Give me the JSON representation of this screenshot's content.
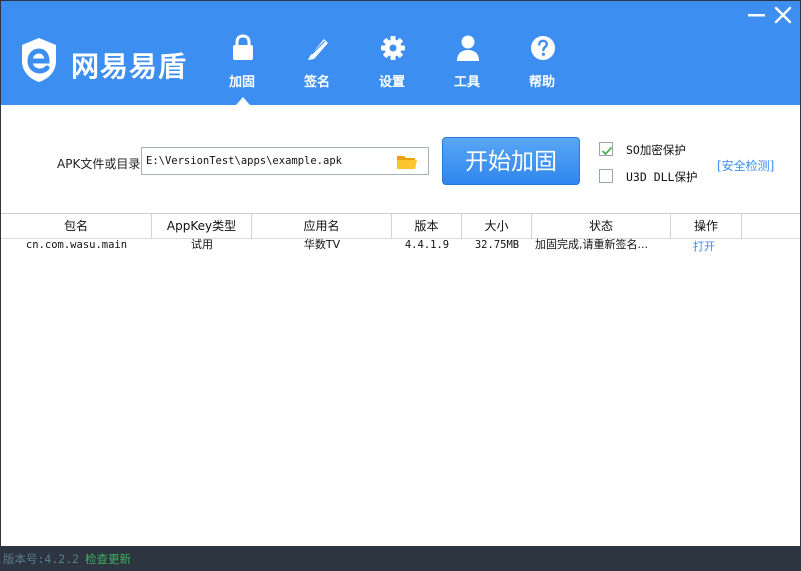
{
  "app": {
    "name": "网易易盾"
  },
  "window": {
    "minimize_icon": "minimize-icon",
    "close_icon": "close-icon"
  },
  "nav": [
    {
      "id": "harden",
      "label": "加固",
      "icon": "lock-icon",
      "selected": true
    },
    {
      "id": "sign",
      "label": "签名",
      "icon": "pencil-icon"
    },
    {
      "id": "settings",
      "label": "设置",
      "icon": "gear-icon"
    },
    {
      "id": "tools",
      "label": "工具",
      "icon": "person-icon"
    },
    {
      "id": "help",
      "label": "帮助",
      "icon": "help-icon"
    }
  ],
  "form": {
    "apk_label": "APK文件或目录",
    "apk_path": "E:\\VersionTest\\apps\\example.apk",
    "start_button": "开始加固",
    "options": [
      {
        "label": "SO加密保护",
        "checked": true
      },
      {
        "label": "U3D DLL保护",
        "checked": false
      }
    ],
    "security_check_link": "[安全检测]"
  },
  "table": {
    "columns": [
      "包名",
      "AppKey类型",
      "应用名",
      "版本",
      "大小",
      "状态",
      "操作"
    ],
    "rows": [
      {
        "package": "cn.com.wasu.main",
        "appkey_type": "试用",
        "app_name": "华数TV",
        "version": "4.4.1.9",
        "size": "32.75MB",
        "status": "加固完成,请重新签名...",
        "action": "打开"
      }
    ]
  },
  "status_bar": {
    "version": "版本号:4.2.2",
    "check_update": "检查更新"
  },
  "colors": {
    "header": "#3c8ef0",
    "status_bar": "#2c3540",
    "link": "#3c8ef0",
    "update_link": "#3fae5e"
  }
}
